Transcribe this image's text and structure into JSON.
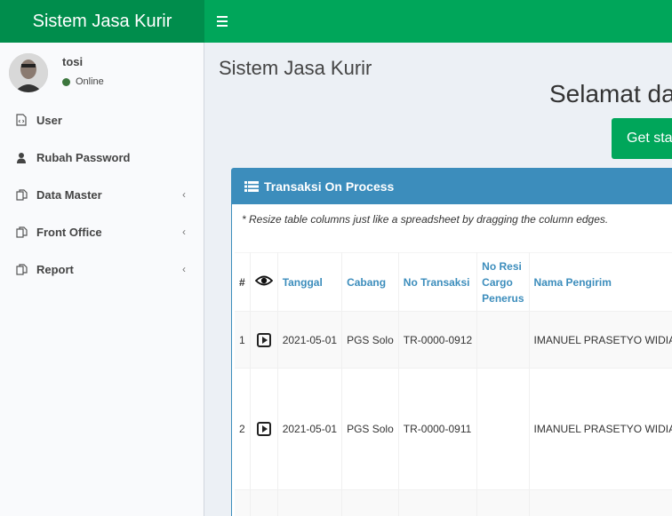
{
  "app": {
    "title": "Sistem Jasa Kurir"
  },
  "colors": {
    "header_dark": "#008d4c",
    "header": "#00a65a",
    "box_primary": "#3c8dbc",
    "online": "#3c763d"
  },
  "user": {
    "name": "tosi",
    "status": "Online"
  },
  "sidebar": {
    "items": [
      {
        "label": "User",
        "icon": "file-code-icon",
        "has_submenu": false
      },
      {
        "label": "Rubah Password",
        "icon": "user-icon",
        "has_submenu": false
      },
      {
        "label": "Data Master",
        "icon": "copy-icon",
        "has_submenu": true
      },
      {
        "label": "Front Office",
        "icon": "copy-icon",
        "has_submenu": true
      },
      {
        "label": "Report",
        "icon": "copy-icon",
        "has_submenu": true
      }
    ]
  },
  "main": {
    "page_title": "Sistem Jasa Kurir",
    "welcome": "Selamat da",
    "get_started": "Get sta"
  },
  "box": {
    "title": "Transaksi On Process",
    "note": "* Resize table columns just like a spreadsheet by dragging the column edges.",
    "columns": [
      "#",
      "",
      "Tanggal",
      "Cabang",
      "No Transaksi",
      "No Resi Cargo Penerus",
      "Nama Pengirim"
    ],
    "rows": [
      {
        "no": "1",
        "tanggal": "2021-05-01",
        "cabang": "PGS Solo",
        "no_transaksi": "TR-0000-0912",
        "no_resi": "",
        "pengirim": "IMANUEL PRASETYO WIDIANTO"
      },
      {
        "no": "2",
        "tanggal": "2021-05-01",
        "cabang": "PGS Solo",
        "no_transaksi": "TR-0000-0911",
        "no_resi": "",
        "pengirim": "IMANUEL PRASETYO WIDIANTO"
      }
    ]
  }
}
